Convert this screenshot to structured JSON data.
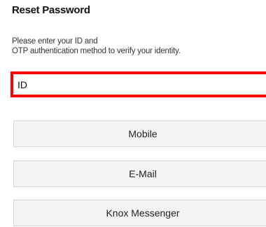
{
  "header": {
    "title": "Reset Password"
  },
  "instructions": {
    "line1": "Please enter your ID and",
    "line2": "OTP authentication method to verify your identity."
  },
  "id_field": {
    "placeholder": "ID",
    "value": ""
  },
  "methods": {
    "mobile_label": "Mobile",
    "email_label": "E-Mail",
    "knox_label": "Knox Messenger"
  },
  "colors": {
    "highlight_border": "#ff0000",
    "button_background": "#f4f4f4",
    "button_border": "#d6d6d6"
  }
}
